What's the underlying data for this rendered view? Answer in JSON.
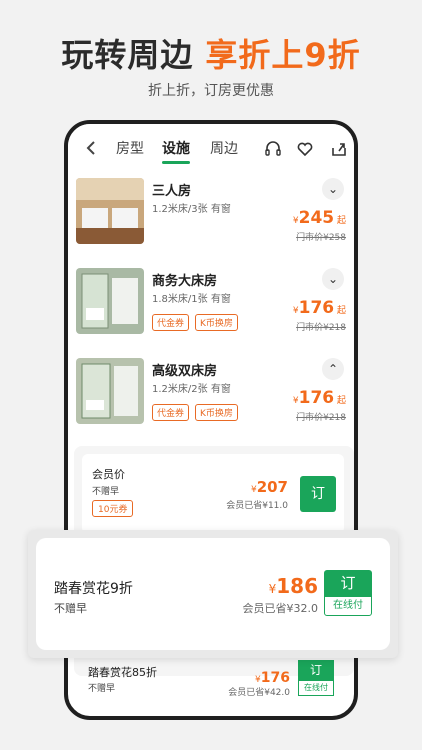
{
  "hero": {
    "title_main": "玩转周边",
    "title_accent": "享折上9折",
    "subtitle": "折上折，订房更优惠"
  },
  "tabs": [
    {
      "label": "房型"
    },
    {
      "label": "设施"
    },
    {
      "label": "周边"
    }
  ],
  "active_tab": "设施",
  "icons": {
    "back": "back-arrow-icon",
    "service": "headset-icon",
    "favorite": "heart-icon",
    "share": "share-icon"
  },
  "rooms": [
    {
      "name": "三人房",
      "spec": "1.2米床/3张 有窗",
      "currency": "¥",
      "price": "245",
      "suffix": "起",
      "orig": "门市价¥258",
      "toggle": "⌄",
      "tags": []
    },
    {
      "name": "商务大床房",
      "spec": "1.8米床/1张 有窗",
      "currency": "¥",
      "price": "176",
      "suffix": "起",
      "orig": "门市价¥218",
      "toggle": "⌄",
      "tags": [
        "代金券",
        "K币换房"
      ]
    },
    {
      "name": "高级双床房",
      "spec": "1.2米床/2张 有窗",
      "currency": "¥",
      "price": "176",
      "suffix": "起",
      "orig": "门市价¥218",
      "toggle": "⌃",
      "tags": [
        "代金券",
        "K币换房"
      ]
    }
  ],
  "plans": [
    {
      "name": "会员价",
      "note": "不赠早",
      "coupon": "10元券",
      "currency": "¥",
      "price": "207",
      "save": "会员已省¥11.0",
      "book": "订"
    }
  ],
  "featured_plan": {
    "name": "踏春赏花9折",
    "note": "不赠早",
    "currency": "¥",
    "price": "186",
    "save": "会员已省¥32.0",
    "book": "订",
    "pay": "在线付"
  },
  "bottom_plan": {
    "name": "踏春赏花85折",
    "note": "不赠早",
    "currency": "¥",
    "price": "176",
    "save": "会员已省¥42.0",
    "book": "订",
    "pay": "在线付"
  },
  "colors": {
    "accent_orange": "#f26a1b",
    "brand_green": "#1aa55a"
  }
}
